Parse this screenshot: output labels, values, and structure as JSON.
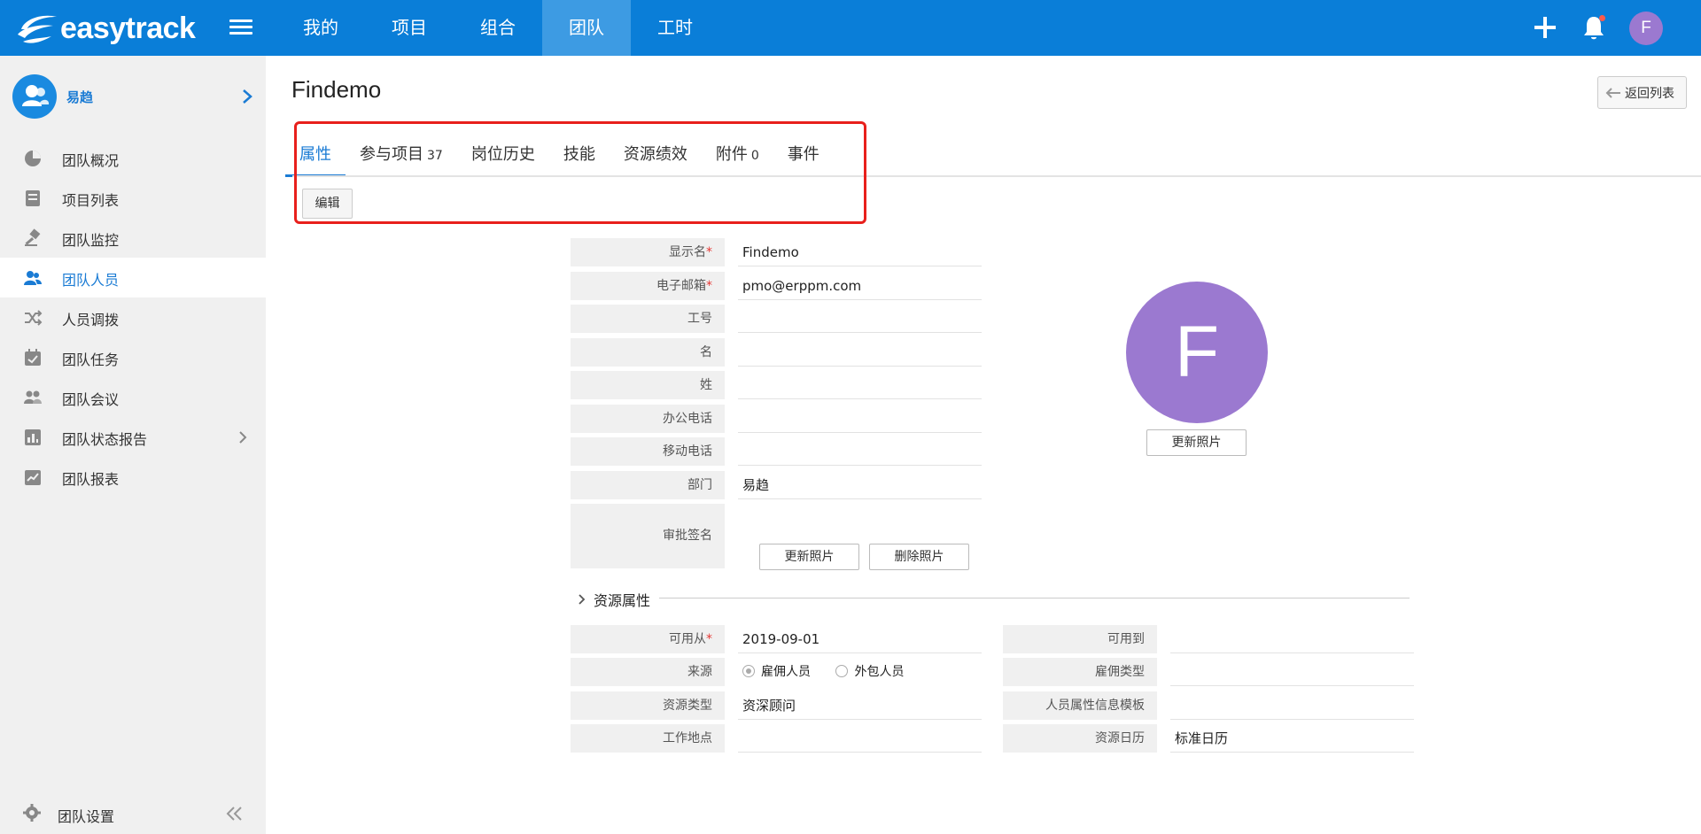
{
  "app": {
    "brand": "easytrack"
  },
  "topnav": {
    "items": [
      {
        "label": "我的"
      },
      {
        "label": "项目"
      },
      {
        "label": "组合"
      },
      {
        "label": "团队"
      },
      {
        "label": "工时"
      }
    ],
    "active_index": 3,
    "user_initial": "F"
  },
  "sidebar": {
    "user_name": "易趋",
    "items": [
      {
        "label": "团队概况",
        "icon": "pie-chart-icon"
      },
      {
        "label": "项目列表",
        "icon": "inbox-icon"
      },
      {
        "label": "团队监控",
        "icon": "gavel-icon"
      },
      {
        "label": "团队人员",
        "icon": "people-icon"
      },
      {
        "label": "人员调拨",
        "icon": "shuffle-icon"
      },
      {
        "label": "团队任务",
        "icon": "calendar-check-icon"
      },
      {
        "label": "团队会议",
        "icon": "meeting-icon"
      },
      {
        "label": "团队状态报告",
        "icon": "bar-report-icon"
      },
      {
        "label": "团队报表",
        "icon": "line-report-icon"
      }
    ],
    "active_index": 3,
    "settings_label": "团队设置"
  },
  "page": {
    "title": "Findemo",
    "back_label": "返回列表",
    "edit_label": "编辑"
  },
  "tabs": [
    {
      "label": "属性",
      "count": ""
    },
    {
      "label": "参与项目",
      "count": "37"
    },
    {
      "label": "岗位历史",
      "count": ""
    },
    {
      "label": "技能",
      "count": ""
    },
    {
      "label": "资源绩效",
      "count": ""
    },
    {
      "label": "附件",
      "count": "0"
    },
    {
      "label": "事件",
      "count": ""
    }
  ],
  "form": {
    "display_name": {
      "label": "显示名",
      "value": "Findemo",
      "required": "*"
    },
    "email": {
      "label": "电子邮箱",
      "value": "pmo@erppm.com",
      "required": "*"
    },
    "employee_no": {
      "label": "工号",
      "value": ""
    },
    "first_name": {
      "label": "名",
      "value": ""
    },
    "last_name": {
      "label": "姓",
      "value": ""
    },
    "office_phone": {
      "label": "办公电话",
      "value": ""
    },
    "mobile_phone": {
      "label": "移动电话",
      "value": ""
    },
    "department": {
      "label": "部门",
      "value": "易趋"
    },
    "signature": {
      "label": "审批签名",
      "update_label": "更新照片",
      "delete_label": "删除照片"
    }
  },
  "avatar": {
    "initial": "F",
    "update_label": "更新照片",
    "color": "#9b79d0"
  },
  "resource": {
    "section_title": "资源属性",
    "available_from": {
      "label": "可用从",
      "value": "2019-09-01",
      "required": "*"
    },
    "available_to": {
      "label": "可用到",
      "value": ""
    },
    "source": {
      "label": "来源",
      "options": [
        "雇佣人员",
        "外包人员"
      ],
      "selected": "雇佣人员"
    },
    "employment_type": {
      "label": "雇佣类型",
      "value": ""
    },
    "resource_type": {
      "label": "资源类型",
      "value": "资深顾问"
    },
    "info_template": {
      "label": "人员属性信息模板",
      "value": ""
    },
    "work_location": {
      "label": "工作地点",
      "value": ""
    },
    "calendar": {
      "label": "资源日历",
      "value": "标准日历"
    }
  },
  "colors": {
    "primary": "#0a7ed8",
    "active_nav": "#3d9be3",
    "link": "#1a7bd4",
    "highlight": "#e8201c",
    "avatar": "#9b79d0"
  }
}
